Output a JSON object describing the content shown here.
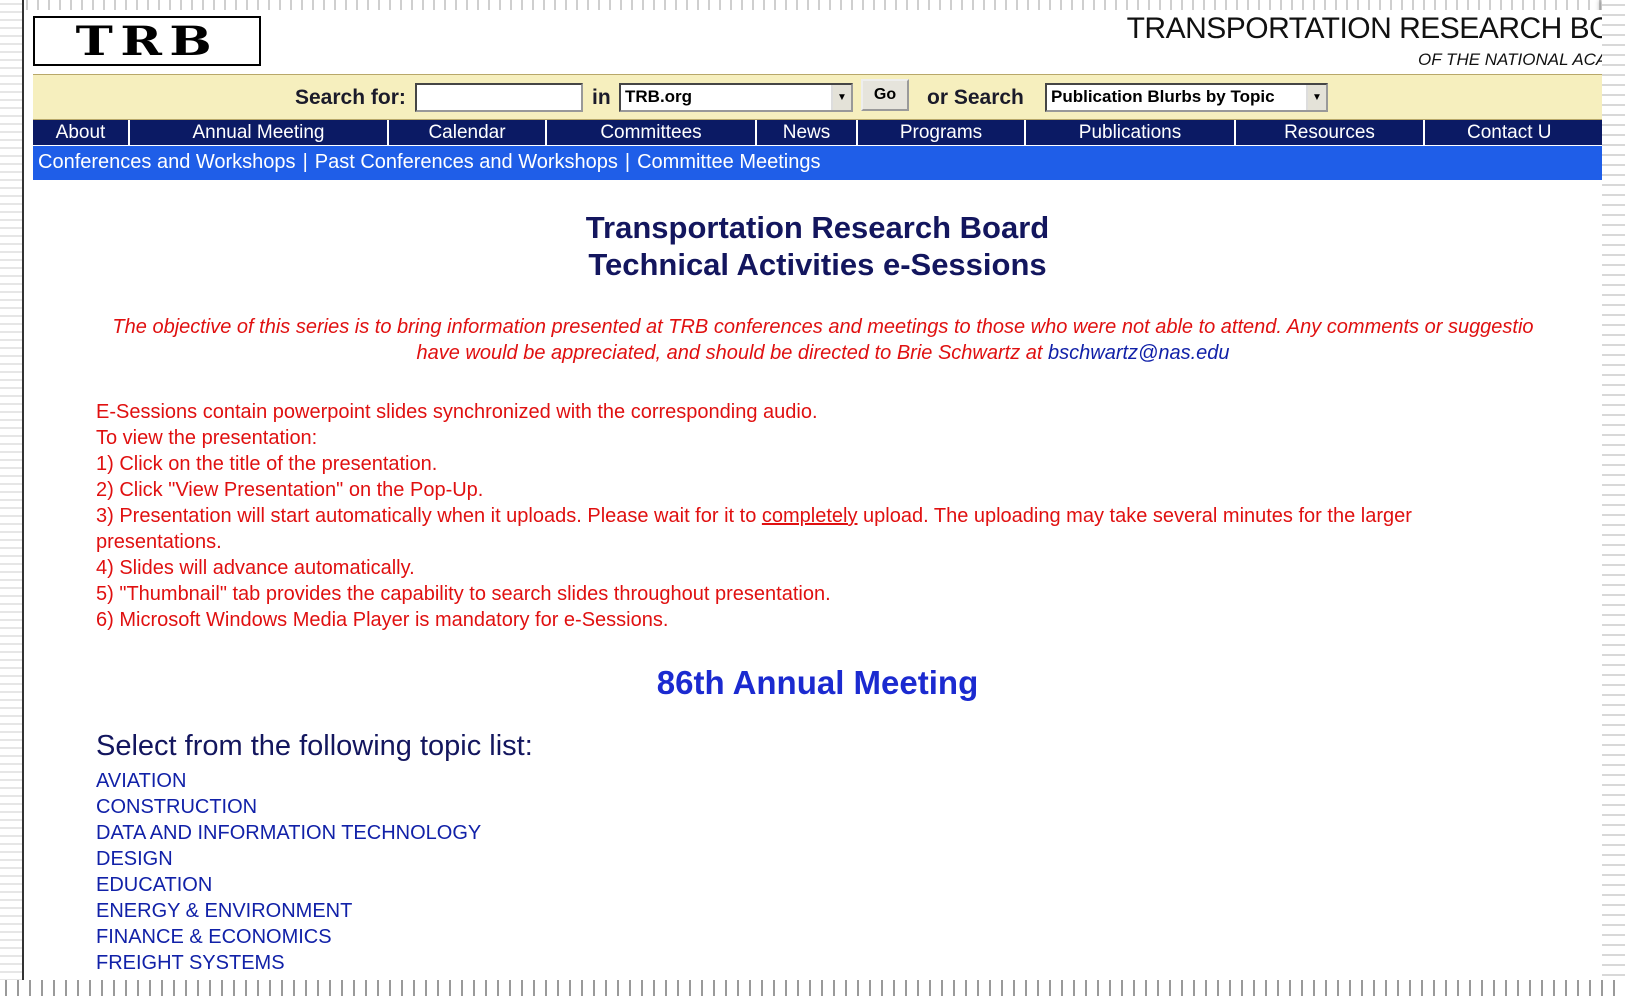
{
  "header": {
    "logo_text": "TRB",
    "org_name": "TRANSPORTATION RESEARCH BO",
    "org_sub": "OF THE NATIONAL ACAI"
  },
  "search": {
    "search_for_label": "Search for:",
    "query_value": "",
    "in_label": "in",
    "scope_value": "TRB.org",
    "go_label": "Go",
    "or_search_label": "or Search",
    "alt_scope_value": "Publication Blurbs by Topic"
  },
  "nav": {
    "items": [
      {
        "label": "About"
      },
      {
        "label": "Annual Meeting"
      },
      {
        "label": "Calendar"
      },
      {
        "label": "Committees"
      },
      {
        "label": "News"
      },
      {
        "label": "Programs"
      },
      {
        "label": "Publications"
      },
      {
        "label": "Resources"
      },
      {
        "label": "Contact U"
      }
    ]
  },
  "subnav": {
    "links": [
      "Conferences and Workshops",
      "Past Conferences and Workshops",
      "Committee Meetings"
    ],
    "separator": "|"
  },
  "main": {
    "title_line1": "Transportation Research Board",
    "title_line2": "Technical Activities e-Sessions",
    "intro_line1": "The objective of this series is to bring information presented at TRB conferences and meetings to those who were not able to attend. Any comments or suggestio",
    "intro_line2_prefix": "have would be appreciated, and should be directed to Brie Schwartz at ",
    "contact_email": "bschwartz@nas.edu",
    "instructions": {
      "line1": "E-Sessions contain powerpoint slides synchronized with the corresponding audio.",
      "line2": "To view the presentation:",
      "step1": "1) Click on the title of the presentation.",
      "step2": "2) Click \"View Presentation\" on the Pop-Up.",
      "step3_prefix": "3) Presentation will start automatically when it uploads. Please wait for it to ",
      "step3_underlined": "completely",
      "step3_suffix": " upload. The uploading may take several minutes for the larger presentations.",
      "step4": "4) Slides will advance automatically.",
      "step5": "5) \"Thumbnail\" tab provides the capability to search slides throughout presentation.",
      "step6": "6) Microsoft Windows Media Player is mandatory for e-Sessions."
    },
    "meeting_heading": "86th Annual Meeting",
    "topic_list_heading": "Select from the following topic list:",
    "topics": [
      "AVIATION",
      "CONSTRUCTION",
      "DATA AND INFORMATION TECHNOLOGY",
      "DESIGN",
      "EDUCATION",
      "ENERGY & ENVIRONMENT",
      "FINANCE & ECONOMICS",
      "FREIGHT SYSTEMS"
    ]
  },
  "colors": {
    "search_bar_bg": "#f6efbe",
    "nav_bg": "#0b1a64",
    "subnav_bg": "#1f5ee8",
    "title_color": "#13165e",
    "intro_red": "#e01010",
    "link_blue": "#1121a8",
    "meeting_blue": "#1b2ad0"
  }
}
